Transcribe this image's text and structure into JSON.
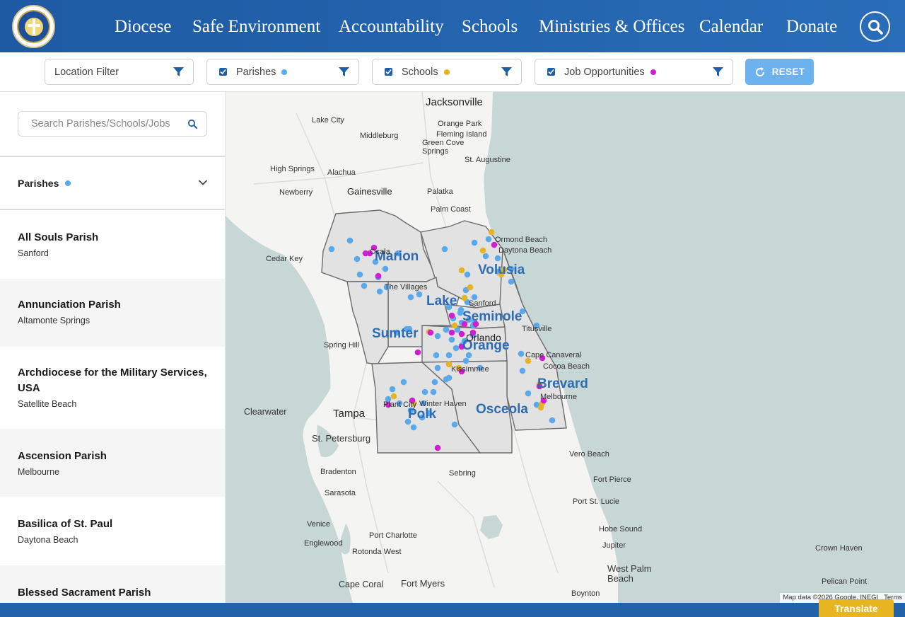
{
  "header": {
    "nav": [
      "Diocese",
      "Safe Environment",
      "Accountability",
      "Schools",
      "Ministries & Offices",
      "Calendar",
      "Donate"
    ]
  },
  "filters": {
    "location": "Location Filter",
    "parishes": "Parishes",
    "schools": "Schools",
    "jobs": "Job Opportunities",
    "reset": "RESET"
  },
  "colors": {
    "parish": "#5aa9ec",
    "school": "#e7b320",
    "job": "#d21ed2",
    "brand": "#2162a9"
  },
  "sidebar": {
    "search_placeholder": "Search Parishes/Schools/Jobs",
    "section_label": "Parishes",
    "items": [
      {
        "name": "All Souls Parish",
        "city": "Sanford"
      },
      {
        "name": "Annunciation Parish",
        "city": "Altamonte Springs"
      },
      {
        "name": "Archdiocese for the Military Services, USA",
        "city": "Satellite Beach"
      },
      {
        "name": "Ascension Parish",
        "city": "Melbourne"
      },
      {
        "name": "Basilica of St. Paul",
        "city": "Daytona Beach"
      },
      {
        "name": "Blessed Sacrament Parish",
        "city": ""
      }
    ]
  },
  "map": {
    "cities": [
      "Jacksonville",
      "Lake City",
      "Middleburg",
      "Orange Park",
      "Fleming Island",
      "Green Cove Springs",
      "St. Augustine",
      "High Springs",
      "Alachua",
      "Newberry",
      "Gainesville",
      "Palatka",
      "Palm Coast",
      "Ormond Beach",
      "Daytona Beach",
      "Cedar Key",
      "The Villages",
      "Sanford",
      "Titusville",
      "Spring Hill",
      "Orlando",
      "Kissimmee",
      "Cocoa Beach",
      "Cape Canaveral",
      "Melbourne",
      "Clearwater",
      "Tampa",
      "Plant City",
      "Winter Haven",
      "St. Petersburg",
      "Vero Beach",
      "Bradenton",
      "Sebring",
      "Fort Pierce",
      "Sarasota",
      "Port St. Lucie",
      "Venice",
      "Port Charlotte",
      "Hobe Sound",
      "Englewood",
      "Rotonda West",
      "Jupiter",
      "Crown Haven",
      "West Palm Beach",
      "Pelican Point",
      "Cape Coral",
      "Fort Myers",
      "Boynton",
      "Ocala"
    ],
    "counties": [
      "Marion",
      "Volusia",
      "Lake",
      "Seminole",
      "Sumter",
      "Orange",
      "Brevard",
      "Polk",
      "Osceola"
    ],
    "attribution": "Map data ©2026 Google, INEGI",
    "terms": "Terms"
  },
  "footer": {
    "translate": "Translate"
  }
}
